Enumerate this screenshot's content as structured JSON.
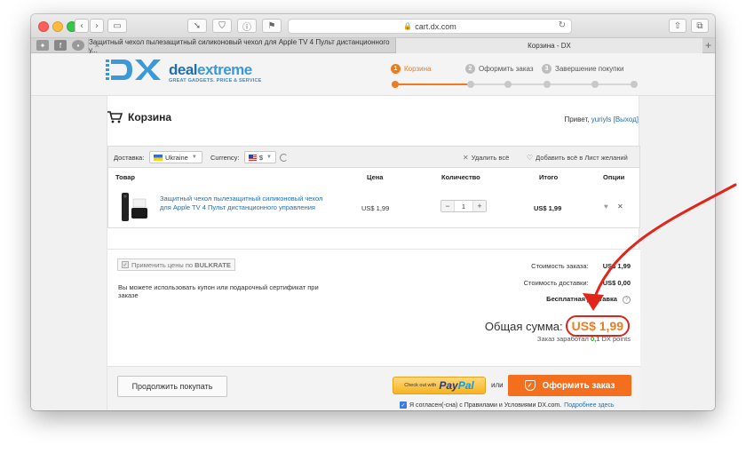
{
  "browser": {
    "url": "cart.dx.com",
    "tabs": [
      {
        "label": "Защитный чехол пылезащитный силиконовый чехол для Apple TV 4 Пульт дистанционного у..."
      },
      {
        "label": "Корзина - DX"
      }
    ]
  },
  "brand": {
    "logo_dx": "DX",
    "name_part1": "deal",
    "name_part2": "extreme",
    "tagline": "GREAT GADGETS. PRICE & SERVICE"
  },
  "steps": [
    {
      "num": "1",
      "label": "Корзина",
      "active": true
    },
    {
      "num": "2",
      "label": "Оформить заказ",
      "active": false
    },
    {
      "num": "3",
      "label": "Завершение покупки",
      "active": false
    }
  ],
  "cart": {
    "title": "Корзина",
    "greeting_prefix": "Привет,",
    "user": "yuriyls",
    "logout": "[Выход]"
  },
  "toolbar": {
    "delivery_label": "Доставка:",
    "delivery_value": "Ukraine",
    "currency_label": "Currency:",
    "currency_value": "$",
    "delete_all": "Удалить всё",
    "add_wishlist": "Добавить всё в Лист желаний"
  },
  "table": {
    "headers": {
      "product": "Товар",
      "price": "Цена",
      "qty": "Количество",
      "total": "Итого",
      "options": "Опции"
    },
    "rows": [
      {
        "name": "Защитный чехол пылезащитный силиконовый чехол для Apple TV 4 Пульт дистанционного управления",
        "price": "US$ 1,99",
        "qty": "1",
        "total": "US$ 1,99"
      }
    ]
  },
  "summary": {
    "bulkrate_prefix": "Применить цены по",
    "bulkrate_bold": "BULKRATE",
    "coupon_text": "Вы можете использовать купон или подарочный сертификат при заказе",
    "order_cost_label": "Стоимость заказа:",
    "order_cost_value": "US$ 1,99",
    "shipping_label": "Стоимость доставки:",
    "shipping_value": "US$ 0,00",
    "free_shipping": "Бесплатная доставка",
    "total_label": "Общая сумма:",
    "total_value": "US$ 1,99",
    "earned_prefix": "Заказ заработал",
    "earned_points": "0,1",
    "earned_suffix": "DX points"
  },
  "actions": {
    "continue": "Продолжить покупать",
    "paypal_pre": "Check out with",
    "paypal_1": "Pay",
    "paypal_2": "Pal",
    "or": "или",
    "checkout": "Оформить заказ",
    "agree_text": "Я согласен(-сна) с Правилами и Условиями DX.com.",
    "agree_more": "Подробнее здесь"
  },
  "colors": {
    "accent": "#f07b1d",
    "link": "#1f6fb2",
    "highlight_arrow": "#e0261b"
  }
}
